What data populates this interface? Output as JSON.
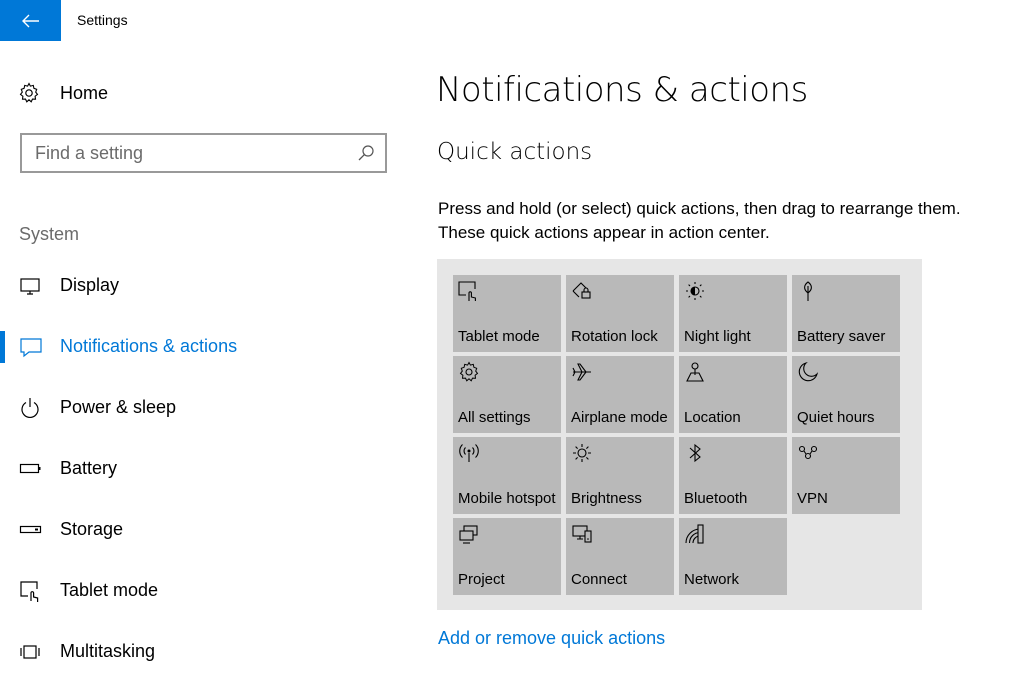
{
  "window": {
    "title": "Settings"
  },
  "sidebar": {
    "home_label": "Home",
    "search_placeholder": "Find a setting",
    "section_label": "System",
    "items": [
      {
        "label": "Display",
        "icon": "monitor-icon",
        "active": false
      },
      {
        "label": "Notifications & actions",
        "icon": "message-icon",
        "active": true
      },
      {
        "label": "Power & sleep",
        "icon": "power-icon",
        "active": false
      },
      {
        "label": "Battery",
        "icon": "battery-icon",
        "active": false
      },
      {
        "label": "Storage",
        "icon": "storage-icon",
        "active": false
      },
      {
        "label": "Tablet mode",
        "icon": "tablet-mode-icon",
        "active": false
      },
      {
        "label": "Multitasking",
        "icon": "multitasking-icon",
        "active": false
      }
    ]
  },
  "main": {
    "title": "Notifications & actions",
    "subtitle": "Quick actions",
    "description": "Press and hold (or select) quick actions, then drag to rearrange them. These quick actions appear in action center.",
    "tiles": [
      {
        "label": "Tablet mode",
        "icon": "tablet-mode-icon"
      },
      {
        "label": "Rotation lock",
        "icon": "rotation-lock-icon"
      },
      {
        "label": "Night light",
        "icon": "night-light-icon"
      },
      {
        "label": "Battery saver",
        "icon": "battery-saver-icon"
      },
      {
        "label": "All settings",
        "icon": "gear-icon"
      },
      {
        "label": "Airplane mode",
        "icon": "airplane-icon"
      },
      {
        "label": "Location",
        "icon": "location-icon"
      },
      {
        "label": "Quiet hours",
        "icon": "moon-icon"
      },
      {
        "label": "Mobile hotspot",
        "icon": "hotspot-icon"
      },
      {
        "label": "Brightness",
        "icon": "brightness-icon"
      },
      {
        "label": "Bluetooth",
        "icon": "bluetooth-icon"
      },
      {
        "label": "VPN",
        "icon": "vpn-icon"
      },
      {
        "label": "Project",
        "icon": "project-icon"
      },
      {
        "label": "Connect",
        "icon": "connect-icon"
      },
      {
        "label": "Network",
        "icon": "network-icon"
      }
    ],
    "link_label": "Add or remove quick actions"
  },
  "colors": {
    "accent": "#0078d7",
    "tile": "#b9b9b9",
    "panel": "#e6e6e6"
  }
}
